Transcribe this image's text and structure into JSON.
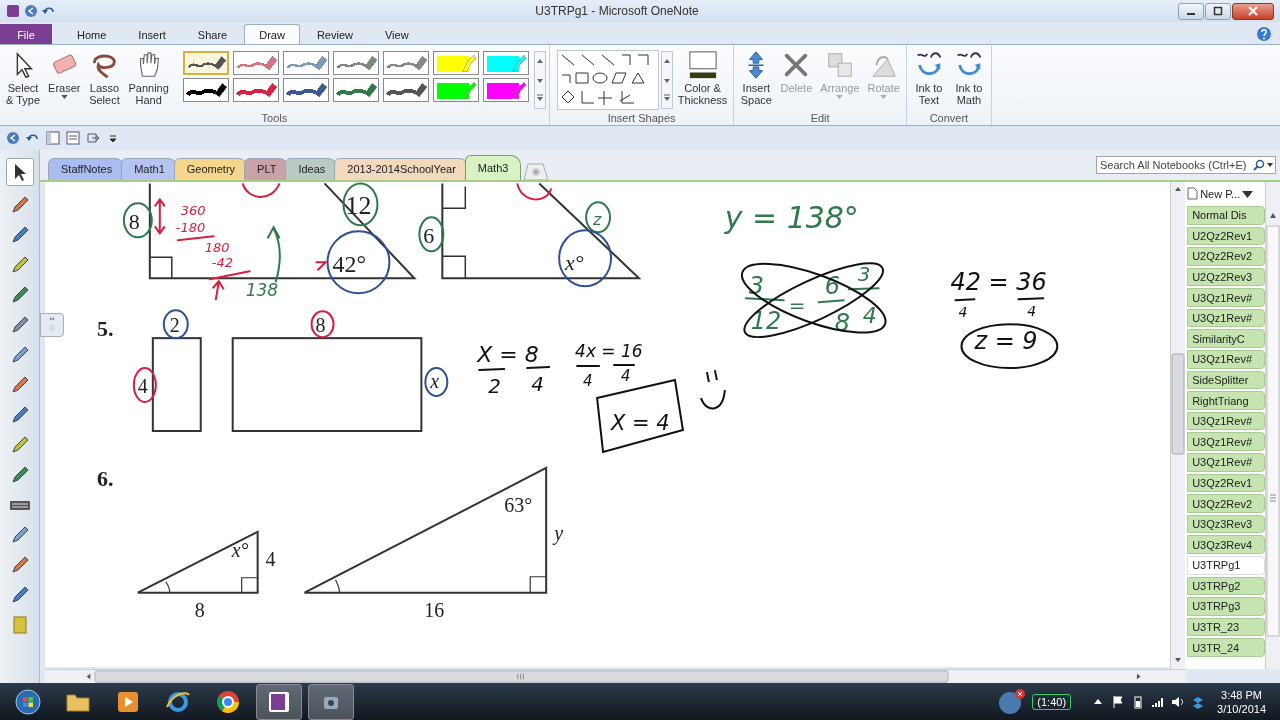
{
  "window": {
    "title": "U3TRPg1 - Microsoft OneNote"
  },
  "ribbon_tabs": [
    {
      "label": "File",
      "kind": "file",
      "selected": false
    },
    {
      "label": "Home",
      "kind": "tab",
      "selected": false
    },
    {
      "label": "Insert",
      "kind": "tab",
      "selected": false
    },
    {
      "label": "Share",
      "kind": "tab",
      "selected": false
    },
    {
      "label": "Draw",
      "kind": "tab",
      "selected": true
    },
    {
      "label": "Review",
      "kind": "tab",
      "selected": false
    },
    {
      "label": "View",
      "kind": "tab",
      "selected": false
    }
  ],
  "ribbon": {
    "groups": [
      {
        "kind": "tools",
        "label": "Tools",
        "buttons": [
          {
            "label": "Select\n& Type",
            "dropdown": false
          },
          {
            "label": "Eraser",
            "dropdown": true
          },
          {
            "label": "Lasso\nSelect",
            "dropdown": false
          },
          {
            "label": "Panning\nHand",
            "dropdown": false
          }
        ],
        "pens": [
          {
            "kind": "pen",
            "color": "#555555",
            "selected": true
          },
          {
            "kind": "pen",
            "color": "#e07080",
            "selected": false
          },
          {
            "kind": "pen",
            "color": "#7a9ab8",
            "selected": false
          },
          {
            "kind": "pen",
            "color": "#7a8a7a",
            "selected": false
          },
          {
            "kind": "pen",
            "color": "#888888",
            "selected": false
          },
          {
            "kind": "highlighter",
            "color": "#ffff00",
            "selected": false
          },
          {
            "kind": "highlighter",
            "color": "#00ffff",
            "selected": false
          },
          {
            "kind": "thick",
            "color": "#000000",
            "selected": false
          },
          {
            "kind": "thick",
            "color": "#e02040",
            "selected": false
          },
          {
            "kind": "thick",
            "color": "#3a5a90",
            "selected": false
          },
          {
            "kind": "thick",
            "color": "#2e7a4a",
            "selected": false
          },
          {
            "kind": "thick",
            "color": "#555555",
            "selected": false
          },
          {
            "kind": "highlighter",
            "color": "#00ff00",
            "selected": false
          },
          {
            "kind": "highlighter",
            "color": "#ff00ff",
            "selected": false
          }
        ]
      },
      {
        "kind": "shapes",
        "label": "Insert Shapes",
        "buttons": [
          {
            "label": "Color &\nThickness",
            "dropdown": false
          }
        ]
      },
      {
        "kind": "edit",
        "label": "Edit",
        "buttons": [
          {
            "label": "Insert\nSpace",
            "disabled": false,
            "dropdown": false
          },
          {
            "label": "Delete",
            "disabled": true,
            "dropdown": false
          },
          {
            "label": "Arrange",
            "disabled": true,
            "dropdown": true
          },
          {
            "label": "Rotate",
            "disabled": true,
            "dropdown": true
          }
        ]
      },
      {
        "kind": "convert",
        "label": "Convert",
        "buttons": [
          {
            "label": "Ink to\nText",
            "dropdown": false
          },
          {
            "label": "Ink to\nMath",
            "dropdown": false
          }
        ]
      }
    ]
  },
  "section_tabs": [
    {
      "label": "StaffNotes",
      "color": "#a9bdf0",
      "selected": false
    },
    {
      "label": "Math1",
      "color": "#b6c4f2",
      "selected": false
    },
    {
      "label": "Geometry",
      "color": "#f6d68c",
      "selected": false
    },
    {
      "label": "PLT",
      "color": "#c9a2a8",
      "selected": false
    },
    {
      "label": "Ideas",
      "color": "#b8cbc2",
      "selected": false
    },
    {
      "label": "2013-2014SchoolYear",
      "color": "#f2d8bd",
      "selected": false
    },
    {
      "label": "Math3",
      "color": "#d9f2c4",
      "selected": true
    }
  ],
  "search": {
    "placeholder": "Search All Notebooks (Ctrl+E)"
  },
  "canvas": {
    "printed": [
      {
        "text": "5."
      },
      {
        "text": "6."
      },
      {
        "text": "8"
      },
      {
        "text": "12"
      },
      {
        "text": "42°"
      },
      {
        "text": "6"
      },
      {
        "text": "x°"
      },
      {
        "text": "2"
      },
      {
        "text": "8"
      },
      {
        "text": "4"
      },
      {
        "text": "x"
      },
      {
        "text": "x°"
      },
      {
        "text": "4"
      },
      {
        "text": "8"
      },
      {
        "text": "63°"
      },
      {
        "text": "y"
      },
      {
        "text": "16"
      }
    ],
    "ink": [
      {
        "text": "360",
        "color": "#d42040"
      },
      {
        "text": "-180",
        "color": "#d42040"
      },
      {
        "text": "180",
        "color": "#d42040"
      },
      {
        "text": "-42",
        "color": "#d42040"
      },
      {
        "text": "138",
        "color": "#2e7a4a"
      },
      {
        "text": "z",
        "color": "#2e7a4a"
      },
      {
        "text": "y = 138°",
        "color": "#2e7a4a"
      },
      {
        "text": "X = 8",
        "color": "#111111"
      },
      {
        "text": "2",
        "color": "#111111"
      },
      {
        "text": "4",
        "color": "#111111"
      },
      {
        "text": "4x = 16",
        "color": "#111111"
      },
      {
        "text": "4",
        "color": "#111111"
      },
      {
        "text": "4",
        "color": "#111111"
      },
      {
        "text": "X = 4",
        "color": "#111111"
      },
      {
        "text": "3",
        "color": "#2e7a4a"
      },
      {
        "text": "12",
        "color": "#2e7a4a"
      },
      {
        "text": "=",
        "color": "#2e7a4a"
      },
      {
        "text": "6",
        "color": "#2e7a4a"
      },
      {
        "text": "8",
        "color": "#2e7a4a"
      },
      {
        "text": "3",
        "color": "#2e7a4a"
      },
      {
        "text": "4",
        "color": "#2e7a4a"
      },
      {
        "text": "42 = 36",
        "color": "#111111"
      },
      {
        "text": "4",
        "color": "#111111"
      },
      {
        "text": "4",
        "color": "#111111"
      },
      {
        "text": "z = 9",
        "color": "#111111"
      }
    ]
  },
  "pages": {
    "new_page": "New P...",
    "items": [
      {
        "label": "Normal Dis",
        "selected": false
      },
      {
        "label": "U2Qz2Rev1",
        "selected": false
      },
      {
        "label": "U2Qz2Rev2",
        "selected": false
      },
      {
        "label": "U2Qz2Rev3",
        "selected": false
      },
      {
        "label": "U3Qz1Rev#",
        "selected": false
      },
      {
        "label": "U3Qz1Rev#",
        "selected": false
      },
      {
        "label": "SimilarityC",
        "selected": false
      },
      {
        "label": "U3Qz1Rev#",
        "selected": false
      },
      {
        "label": "SideSplitter",
        "selected": false
      },
      {
        "label": "RightTriang",
        "selected": false
      },
      {
        "label": "U3Qz1Rev#",
        "selected": false
      },
      {
        "label": "U3Qz1Rev#",
        "selected": false
      },
      {
        "label": "U3Qz1Rev#",
        "selected": false
      },
      {
        "label": "U3Qz2Rev1",
        "selected": false
      },
      {
        "label": "U3Qz2Rev2",
        "selected": false
      },
      {
        "label": "U3Qz3Rev3",
        "selected": false
      },
      {
        "label": "U3Qz3Rev4",
        "selected": false
      },
      {
        "label": "U3TRPg1",
        "selected": true
      },
      {
        "label": "U3TRPg2",
        "selected": false
      },
      {
        "label": "U3TRPg3",
        "selected": false
      },
      {
        "label": "U3TR_23",
        "selected": false
      },
      {
        "label": "U3TR_24",
        "selected": false
      }
    ]
  },
  "taskbar": {
    "battery": "(1:40)",
    "time": "3:48 PM",
    "date": "3/10/2014"
  }
}
